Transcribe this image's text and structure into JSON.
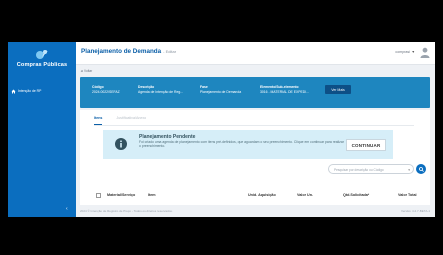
{
  "sidebar": {
    "logo_text": "Compras Públicas",
    "items": [
      {
        "label": "Intenção de RP"
      }
    ],
    "collapse_glyph": "‹"
  },
  "header": {
    "title": "Planejamento de Demanda",
    "subtitle": "- Editar",
    "user": "comprasi",
    "caret": "▼"
  },
  "back_link": "◄ Voltar",
  "banner": {
    "fields": [
      {
        "label": "Código",
        "value": "2024.0022/SEFAZ"
      },
      {
        "label": "Descrição",
        "value": "Agenda de Intenção de Reg..."
      },
      {
        "label": "Fase",
        "value": "Planejamento de Demanda"
      },
      {
        "label": "Elemento/Sub-elemento",
        "value": "3016 - MATERIAL DE EXPEDI..."
      }
    ],
    "see_more_label": "Ver Mais"
  },
  "tabs": [
    {
      "label": "Itens",
      "active": true
    },
    {
      "label": "Justificativa/Anexo",
      "active": false
    }
  ],
  "info": {
    "title": "Planejamento Pendente",
    "text": "Foi criado uma agenda de planejamento com itens pré-definidos, que aguardam o seu preenchimento. Clique em continuar para realizar o preenchimento.",
    "continue_label": "CONTINUAR"
  },
  "search": {
    "placeholder": "Pesquisar por descrição ou Código",
    "dropdown_glyph": "▾"
  },
  "table": {
    "columns": [
      "Material/Serviço",
      "Item",
      "Unid. Aquisição",
      "Valor Un.",
      "Qtd.Solicitada*",
      "Valor Total"
    ]
  },
  "footer": {
    "copyright": "2024 © Intenção de Registro de Preço - Todos os direitos reservados.",
    "version": "Versão: 4.2.7-BETA-1"
  },
  "colors": {
    "sidebar": "#0b6ebf",
    "banner": "#1e86bf",
    "accent": "#0b5fa8",
    "info_bg": "#d6eef8"
  }
}
